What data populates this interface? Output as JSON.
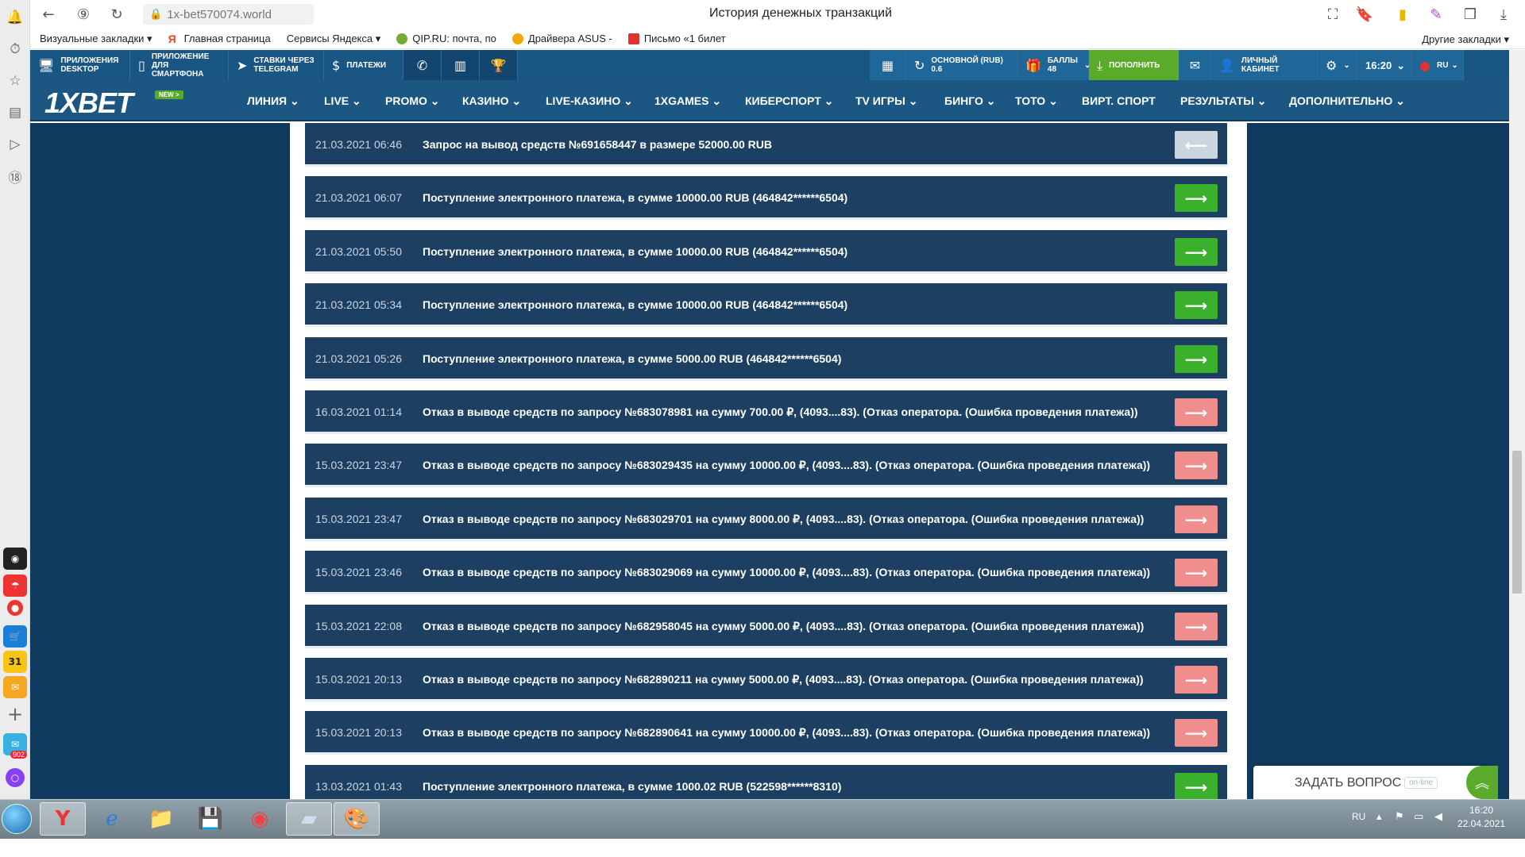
{
  "browser": {
    "url": "1x-bet570074.world",
    "page_title": "История денежных транзакций",
    "bookmarks": [
      {
        "label": "Визуальные закладки ▾",
        "color": "#ffffff"
      },
      {
        "label": "Главная страница",
        "color": "#e42"
      },
      {
        "label": "Сервисы Яндекса ▾",
        "color": "#ffffff"
      },
      {
        "label": "QIP.RU: почта, по",
        "color": "#7a3"
      },
      {
        "label": "Драйвера ASUS -",
        "color": "#444"
      },
      {
        "label": "Письмо «1 билет",
        "color": "#d33"
      }
    ],
    "other_bookmarks": "Другие закладки ▾"
  },
  "topstrip": {
    "apps_desktop": "ПРИЛОЖЕНИЯ DESKTOP",
    "apps_phone": "ПРИЛОЖЕНИЕ ДЛЯ СМАРТФОНА",
    "telegram": "СТАВКИ ЧЕРЕЗ TELEGRAM",
    "payments": "ПЛАТЕЖИ",
    "account_main": "ОСНОВНОЙ (RUB)",
    "balance": "0.6",
    "points_label": "БАЛЛЫ",
    "points_value": "48",
    "deposit": "ПОПОЛНИТЬ",
    "cabinet": "ЛИЧНЫЙ КАБИНЕТ",
    "time": "16:20",
    "lang": "RU"
  },
  "logo": {
    "text": "1XBET",
    "badge": "NEW >"
  },
  "nav": [
    "ЛИНИЯ",
    "LIVE",
    "PROMO",
    "КАЗИНО",
    "LIVE-КАЗИНО",
    "1XGAMES",
    "КИБЕРСПОРТ",
    "TV ИГРЫ",
    "БИНГО",
    "ТОТО",
    "ВИРТ. СПОРТ",
    "РЕЗУЛЬТАТЫ",
    "ДОПОЛНИТЕЛЬНО"
  ],
  "transactions": [
    {
      "date": "21.03.2021 06:46",
      "description": "Запрос на вывод средств №691658447 в размере 52000.00 RUB",
      "type": "request"
    },
    {
      "date": "21.03.2021 06:07",
      "description": "Поступление электронного платежа, в сумме 10000.00 RUB (464842******6504)",
      "type": "income"
    },
    {
      "date": "21.03.2021 05:50",
      "description": "Поступление электронного платежа, в сумме 10000.00 RUB (464842******6504)",
      "type": "income"
    },
    {
      "date": "21.03.2021 05:34",
      "description": "Поступление электронного платежа, в сумме 10000.00 RUB (464842******6504)",
      "type": "income"
    },
    {
      "date": "21.03.2021 05:26",
      "description": "Поступление электронного платежа, в сумме 5000.00 RUB (464842******6504)",
      "type": "income"
    },
    {
      "date": "16.03.2021 01:14",
      "description": "Отказ в выводе средств по запросу №683078981 на сумму 700.00 ₽, (4093....83). (Отказ оператора. (Ошибка проведения платежа))",
      "type": "refusal"
    },
    {
      "date": "15.03.2021 23:47",
      "description": "Отказ в выводе средств по запросу №683029435 на сумму 10000.00 ₽, (4093....83). (Отказ оператора. (Ошибка проведения платежа))",
      "type": "refusal"
    },
    {
      "date": "15.03.2021 23:47",
      "description": "Отказ в выводе средств по запросу №683029701 на сумму 8000.00 ₽, (4093....83). (Отказ оператора. (Ошибка проведения платежа))",
      "type": "refusal"
    },
    {
      "date": "15.03.2021 23:46",
      "description": "Отказ в выводе средств по запросу №683029069 на сумму 10000.00 ₽, (4093....83). (Отказ оператора. (Ошибка проведения платежа))",
      "type": "refusal"
    },
    {
      "date": "15.03.2021 22:08",
      "description": "Отказ в выводе средств по запросу №682958045 на сумму 5000.00 ₽, (4093....83). (Отказ оператора. (Ошибка проведения платежа))",
      "type": "refusal"
    },
    {
      "date": "15.03.2021 20:13",
      "description": "Отказ в выводе средств по запросу №682890211 на сумму 5000.00 ₽, (4093....83). (Отказ оператора. (Ошибка проведения платежа))",
      "type": "refusal"
    },
    {
      "date": "15.03.2021 20:13",
      "description": "Отказ в выводе средств по запросу №682890641 на сумму 10000.00 ₽, (4093....83). (Отказ оператора. (Ошибка проведения платежа))",
      "type": "refusal"
    },
    {
      "date": "13.03.2021 01:43",
      "description": "Поступление электронного платежа, в сумме 1000.02 RUB (522598******8310)",
      "type": "income"
    }
  ],
  "arrow_colors": {
    "request": "#c9d6e0",
    "income": "#3bb02c",
    "refusal": "#f08d8d"
  },
  "arrow_glyphs": {
    "request": "⟵",
    "income": "⟶",
    "refusal": "⟶"
  },
  "chat": {
    "label": "ЗАДАТЬ ВОПРОС",
    "status": "on-line"
  },
  "taskbar": {
    "lang": "RU",
    "time": "16:20",
    "date": "22.04.2021"
  },
  "sidepanel": {
    "badge": "902",
    "calendar_day": "31"
  }
}
